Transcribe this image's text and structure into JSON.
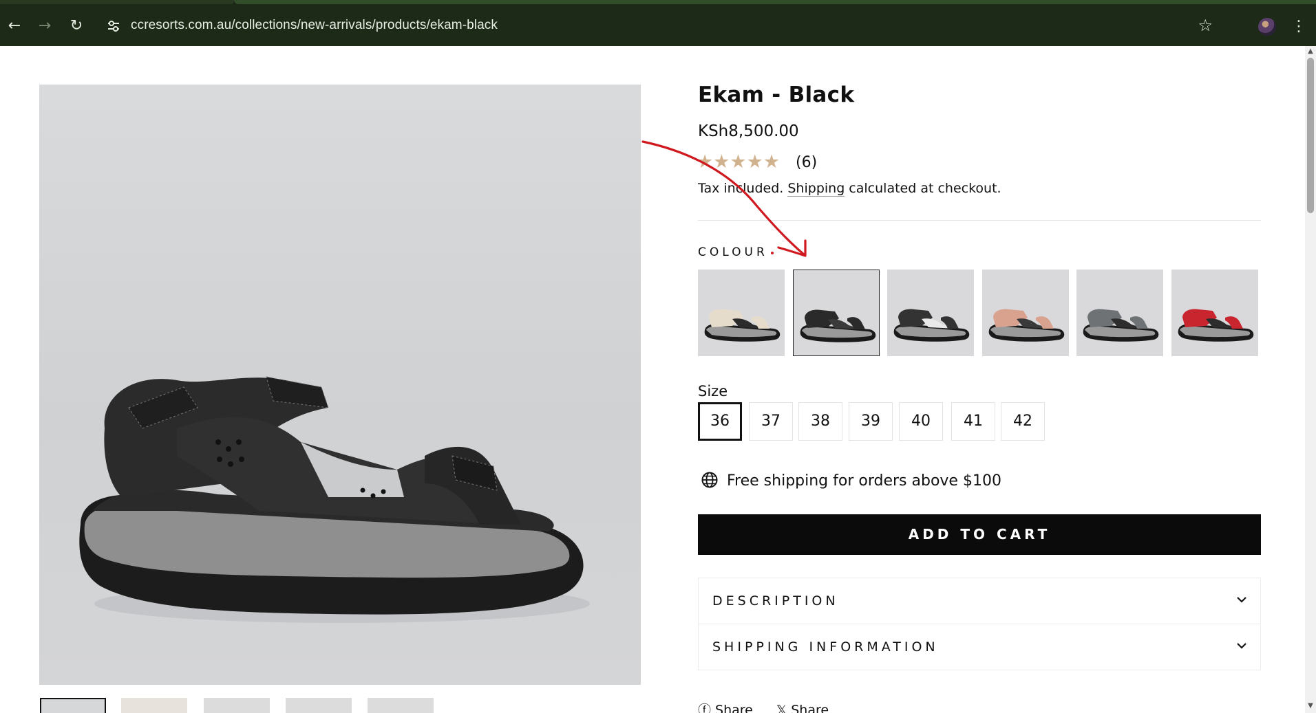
{
  "browser": {
    "url": "ccresorts.com.au/collections/new-arrivals/products/ekam-black",
    "icons": [
      "back-icon",
      "forward-icon",
      "reload-icon",
      "site-info-icon",
      "bookmark-star-icon",
      "profile-avatar",
      "menu-kebab-icon"
    ]
  },
  "product": {
    "title": "Ekam - Black",
    "price": "KSh8,500.00",
    "rating_stars": "★★★★★",
    "rating": 5,
    "review_count": "(6)",
    "tax_prefix": "Tax included. ",
    "shipping_link": "Shipping",
    "tax_suffix": " calculated at checkout."
  },
  "colour": {
    "label": "COLOUR",
    "swatches": [
      {
        "name": "beige",
        "color": "#e6dccb",
        "accent": "#2b2b2b"
      },
      {
        "name": "black",
        "color": "#2a2a2a",
        "accent": "#3b3b3b",
        "selected": true
      },
      {
        "name": "black-white",
        "color": "#333333",
        "accent": "#e9e9e9"
      },
      {
        "name": "pink",
        "color": "#d9a28f",
        "accent": "#3a3a3a"
      },
      {
        "name": "grey",
        "color": "#6e7275",
        "accent": "#2d2d2d"
      },
      {
        "name": "red",
        "color": "#c9252f",
        "accent": "#2d2d2d"
      }
    ]
  },
  "size": {
    "label": "Size",
    "options": [
      "36",
      "37",
      "38",
      "39",
      "40",
      "41",
      "42"
    ],
    "selected": "36"
  },
  "shipping_note": "Free shipping for orders above $100",
  "add_to_cart": "ADD TO CART",
  "accordions": {
    "description": "DESCRIPTION",
    "shipping_information": "SHIPPING INFORMATION"
  },
  "share": {
    "facebook": "Share",
    "x": "Share"
  },
  "colors": {
    "browser_chrome": "#1d2a18",
    "cart_button": "#0b0b0b",
    "star": "#d1b28f",
    "annotation_arrow": "#d0181f"
  }
}
